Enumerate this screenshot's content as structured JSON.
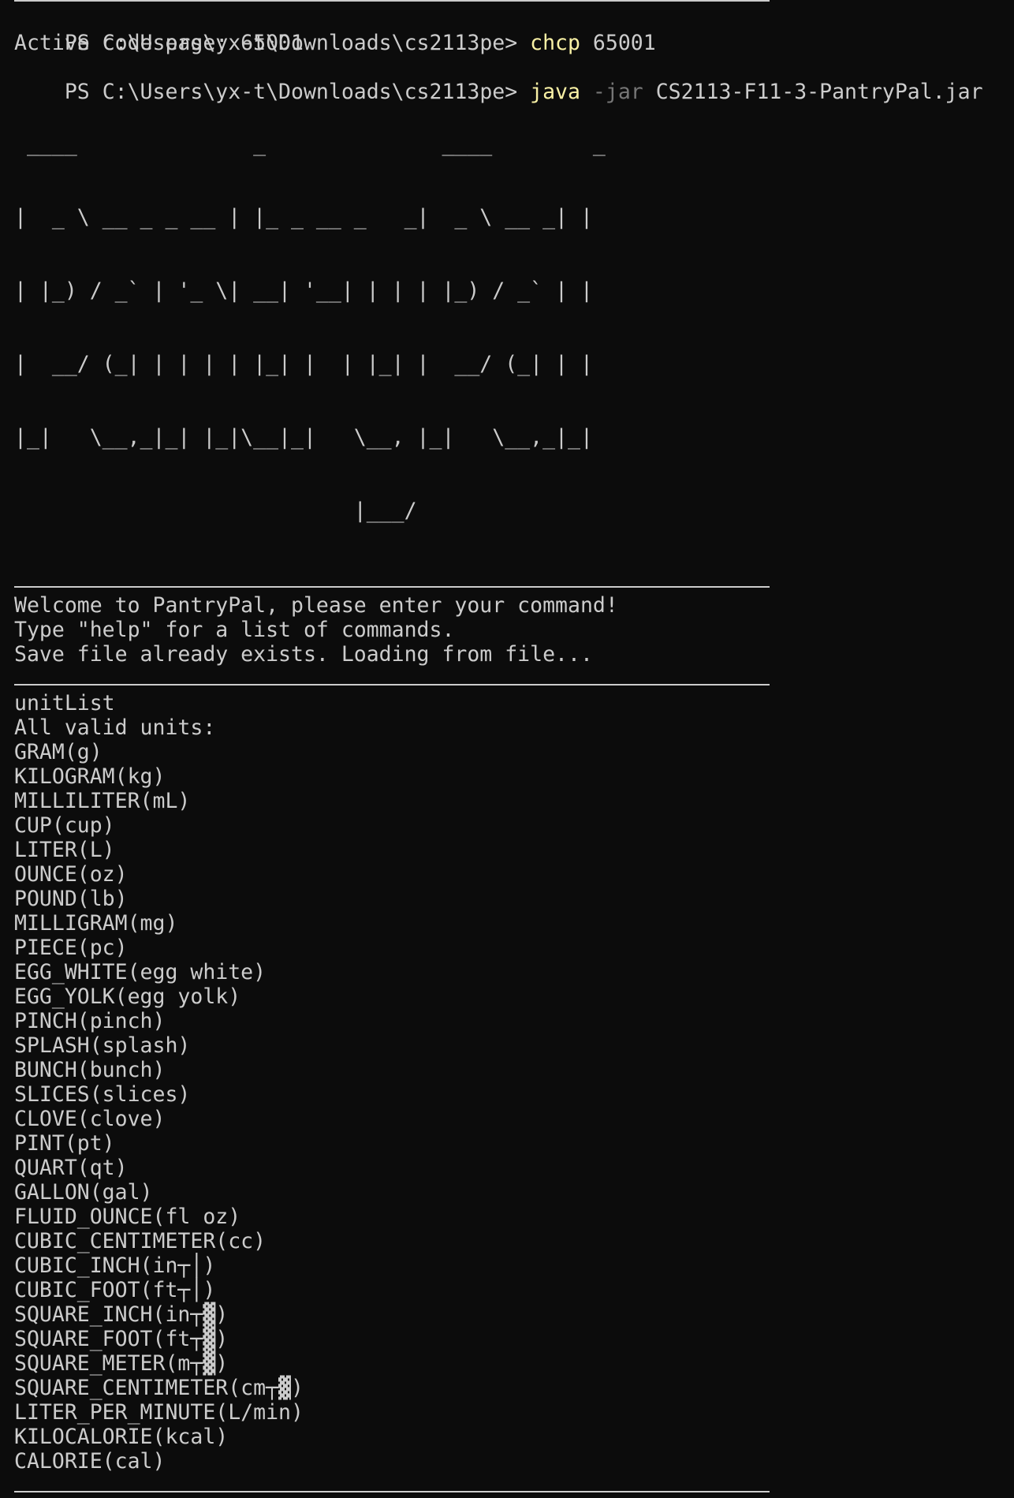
{
  "terminal": {
    "prompt1": "PS C:\\Users\\yx-t\\Downloads\\cs2113pe> ",
    "cmd1": "chcp",
    "cmd1_args": " 65001",
    "line2": "Active code page: 65001",
    "prompt2": "PS C:\\Users\\yx-t\\Downloads\\cs2113pe> ",
    "cmd2": "java",
    "cmd2_flag": " -jar",
    "cmd2_args": " CS2113-F11-3-PantryPal.jar",
    "ascii_art": [
      " ____              _              ____        _ ",
      "|  _ \\ __ _ _ __ | |_ _ __ _   _|  _ \\ __ _| |",
      "| |_) / _` | '_ \\| __| '__| | | | |_) / _` | |",
      "|  __/ (_| | | | | |_| |  | |_| |  __/ (_| | |",
      "|_|   \\__,_|_| |_|\\__|_|   \\__, |_|   \\__,_|_|",
      "                           |___/              "
    ],
    "welcome": [
      "Welcome to PantryPal, please enter your command!",
      "Type \"help\" for a list of commands.",
      "Save file already exists. Loading from file..."
    ],
    "command_echo": "unitList",
    "units_header": "All valid units:",
    "units": [
      "GRAM(g)",
      "KILOGRAM(kg)",
      "MILLILITER(mL)",
      "CUP(cup)",
      "LITER(L)",
      "OUNCE(oz)",
      "POUND(lb)",
      "MILLIGRAM(mg)",
      "PIECE(pc)",
      "EGG_WHITE(egg white)",
      "EGG_YOLK(egg yolk)",
      "PINCH(pinch)",
      "SPLASH(splash)",
      "BUNCH(bunch)",
      "SLICES(slices)",
      "CLOVE(clove)",
      "PINT(pt)",
      "QUART(qt)",
      "GALLON(gal)",
      "FLUID_OUNCE(fl oz)",
      "CUBIC_CENTIMETER(cc)",
      "CUBIC_INCH(in┬│)",
      "CUBIC_FOOT(ft┬│)",
      "SQUARE_INCH(in┬▓)",
      "SQUARE_FOOT(ft┬▓)",
      "SQUARE_METER(m┬▓)",
      "SQUARE_CENTIMETER(cm┬▓)",
      "LITER_PER_MINUTE(L/min)",
      "KILOCALORIE(kcal)",
      "CALORIE(cal)"
    ],
    "colors": {
      "background": "#0c0c0c",
      "text": "#cccccc",
      "command": "#f9f1a5",
      "flag": "#767676"
    }
  }
}
